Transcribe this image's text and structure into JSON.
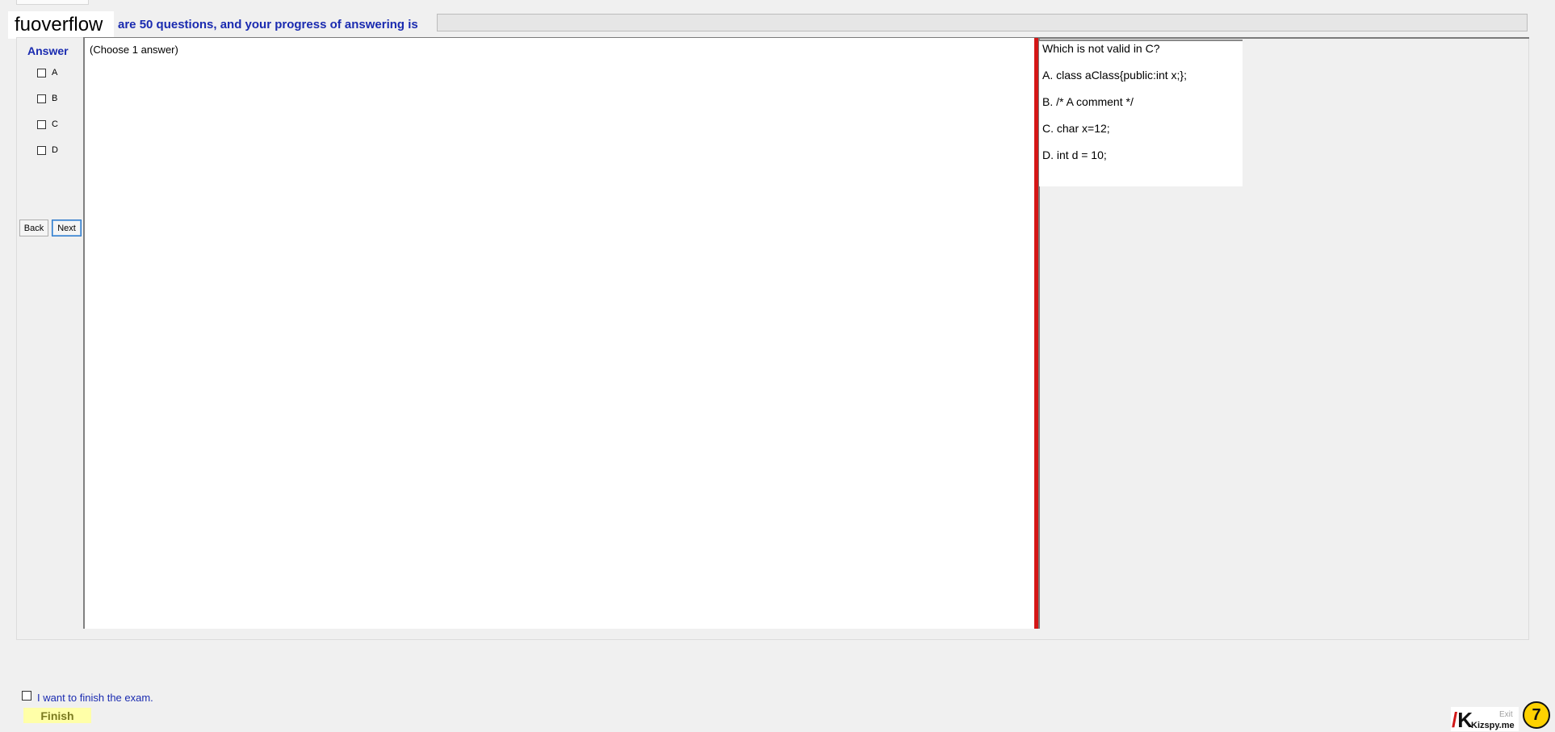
{
  "header": {
    "logo_text": "fuoverflow",
    "progress_text": "are 50 questions, and your progress of answering is",
    "progress_value": 0
  },
  "answer_panel": {
    "title": "Answer",
    "options": [
      "A",
      "B",
      "C",
      "D"
    ],
    "back_label": "Back",
    "next_label": "Next"
  },
  "main": {
    "instruction": "(Choose 1 answer)"
  },
  "question": {
    "prompt": "Which is not valid in C?",
    "choices": [
      "A.  class aClass{public:int x;};",
      "B.  /* A comment */",
      "C.  char x=12;",
      "D.  int d = 10;"
    ]
  },
  "footer": {
    "finish_checkbox_label": "I want to finish the exam.",
    "finish_button_label": "Finish",
    "exit_label": "Exit"
  },
  "watermark": {
    "brand": "Kizspy.me",
    "badge_number": "7"
  }
}
